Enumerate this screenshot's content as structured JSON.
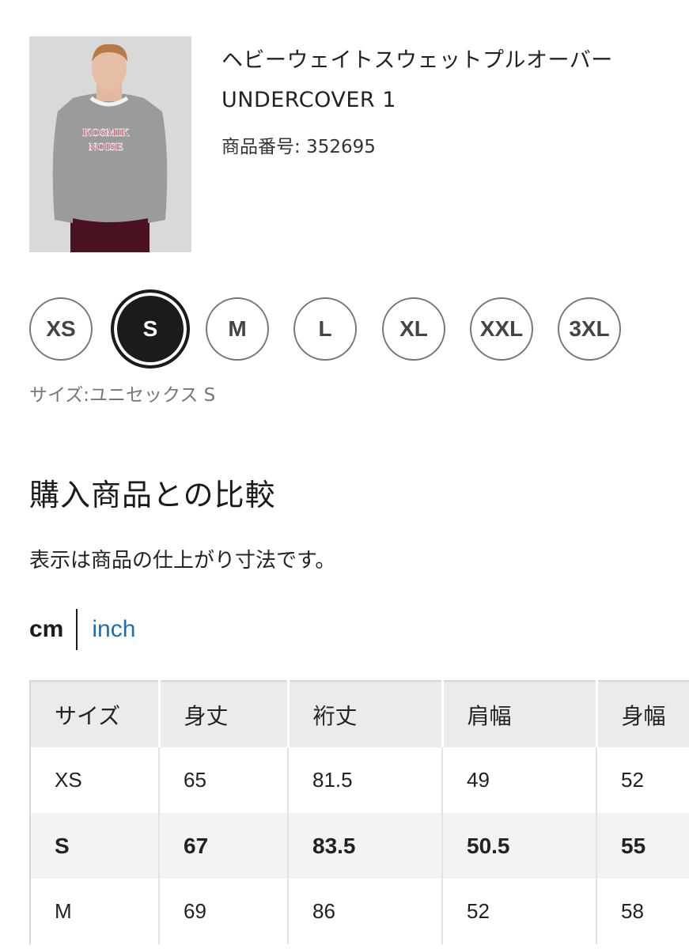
{
  "product": {
    "title": "ヘビーウェイトスウェットプルオーバー UNDERCOVER 1",
    "number": "商品番号: 352695",
    "image_print_line1": "KOSMIK",
    "image_print_line2": "NOISE"
  },
  "sizes": {
    "options": [
      "XS",
      "S",
      "M",
      "L",
      "XL",
      "XXL",
      "3XL"
    ],
    "selected": "S",
    "caption": "サイズ:ユニセックス S"
  },
  "comparison": {
    "heading": "購入商品との比較",
    "note": "表示は商品の仕上がり寸法です。"
  },
  "units": {
    "cm": "cm",
    "inch": "inch",
    "active": "cm"
  },
  "table": {
    "headers": [
      "サイズ",
      "身丈",
      "裄丈",
      "肩幅",
      "身幅"
    ],
    "rows": [
      [
        "XS",
        "65",
        "81.5",
        "49",
        "52"
      ],
      [
        "S",
        "67",
        "83.5",
        "50.5",
        "55"
      ],
      [
        "M",
        "69",
        "86",
        "52",
        "58"
      ]
    ],
    "highlighted_row": 1
  },
  "colors": {
    "sweater": "#9b9b9b",
    "print": "#d8546a",
    "trousers": "#4a1220",
    "link": "#1a6fb5",
    "selected_chip": "#1b1b1b"
  }
}
